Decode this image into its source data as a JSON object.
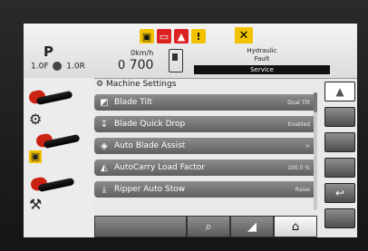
{
  "status": {
    "gear": "P",
    "ratio_left": "1.0F",
    "ratio_right": "1.0R",
    "speed_unit": "0km/h",
    "speed_value": "700",
    "speed_prefix": "0",
    "hydraulic_line1": "Hydraulic",
    "hydraulic_line2": "Fault",
    "service": "Service"
  },
  "menu": {
    "title": "Machine Settings",
    "items": [
      {
        "label": "Blade Tilt",
        "value": "Dual Tilt",
        "icon": "blade-tilt-icon"
      },
      {
        "label": "Blade Quick Drop",
        "value": "Enabled",
        "icon": "blade-drop-icon"
      },
      {
        "label": "Auto Blade Assist",
        "value": ">",
        "icon": "blade-assist-icon"
      },
      {
        "label": "AutoCarry Load Factor",
        "value": "100.0 %",
        "icon": "autocarry-icon"
      },
      {
        "label": "Ripper Auto Stow",
        "value": "Raise",
        "icon": "ripper-icon"
      }
    ]
  },
  "colors": {
    "warning_yellow": "#f2c200",
    "warning_red": "#d22",
    "lever_red": "#c21"
  }
}
